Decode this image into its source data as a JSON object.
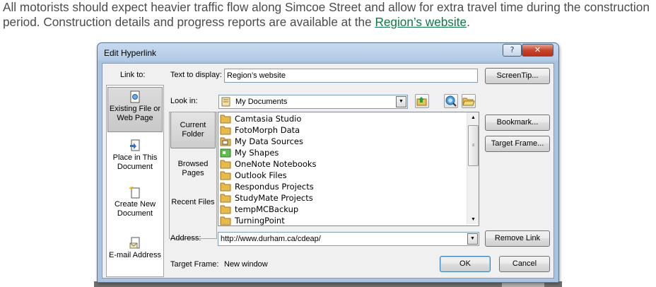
{
  "document": {
    "text_before_link": "All motorists should expect heavier traffic flow along Simcoe Street and allow for extra travel time during the construction period. Construction details and progress reports are available at the ",
    "link_text": "Region’s website",
    "text_after_link": "."
  },
  "dialog": {
    "title": "Edit Hyperlink",
    "help_button": "?",
    "close_button": "✕",
    "link_to_label": "Link to:",
    "link_to_items": [
      {
        "label": "Existing File or Web Page",
        "selected": true,
        "icon": "existing-file-icon"
      },
      {
        "label": "Place in This Document",
        "selected": false,
        "icon": "place-in-document-icon"
      },
      {
        "label": "Create New Document",
        "selected": false,
        "icon": "new-document-icon"
      },
      {
        "label": "E-mail Address",
        "selected": false,
        "icon": "email-icon"
      }
    ],
    "text_to_display_label": "Text to display:",
    "text_to_display_value": "Region’s website",
    "screentip_button": "ScreenTip...",
    "look_in_label": "Look in:",
    "look_in_value": "My Documents",
    "nav_items": [
      {
        "label": "Current Folder",
        "selected": true
      },
      {
        "label": "Browsed Pages",
        "selected": false
      },
      {
        "label": "Recent Files",
        "selected": false
      }
    ],
    "files": [
      {
        "name": "Camtasia Studio",
        "icon": "folder-icon"
      },
      {
        "name": "FotoMorph Data",
        "icon": "folder-icon"
      },
      {
        "name": "My Data Sources",
        "icon": "data-sources-folder-icon"
      },
      {
        "name": "My Shapes",
        "icon": "shapes-folder-icon"
      },
      {
        "name": "OneNote Notebooks",
        "icon": "folder-icon"
      },
      {
        "name": "Outlook Files",
        "icon": "folder-icon"
      },
      {
        "name": "Respondus Projects",
        "icon": "folder-icon"
      },
      {
        "name": "StudyMate Projects",
        "icon": "folder-icon"
      },
      {
        "name": "tempMCBackup",
        "icon": "folder-icon"
      },
      {
        "name": "TurningPoint",
        "icon": "folder-icon"
      }
    ],
    "bookmark_button": "Bookmark...",
    "target_frame_button": "Target Frame...",
    "address_label": "Address:",
    "address_value": "http://www.durham.ca/cdeap/",
    "remove_link_button": "Remove Link",
    "target_frame_label": "Target Frame:",
    "target_frame_value": "New window",
    "ok_button": "OK",
    "cancel_button": "Cancel",
    "colors": {
      "link": "#0a7a45",
      "title_bar": "#b4cbe6",
      "close_button": "#c8452c",
      "folder": "#e8b84a"
    }
  }
}
